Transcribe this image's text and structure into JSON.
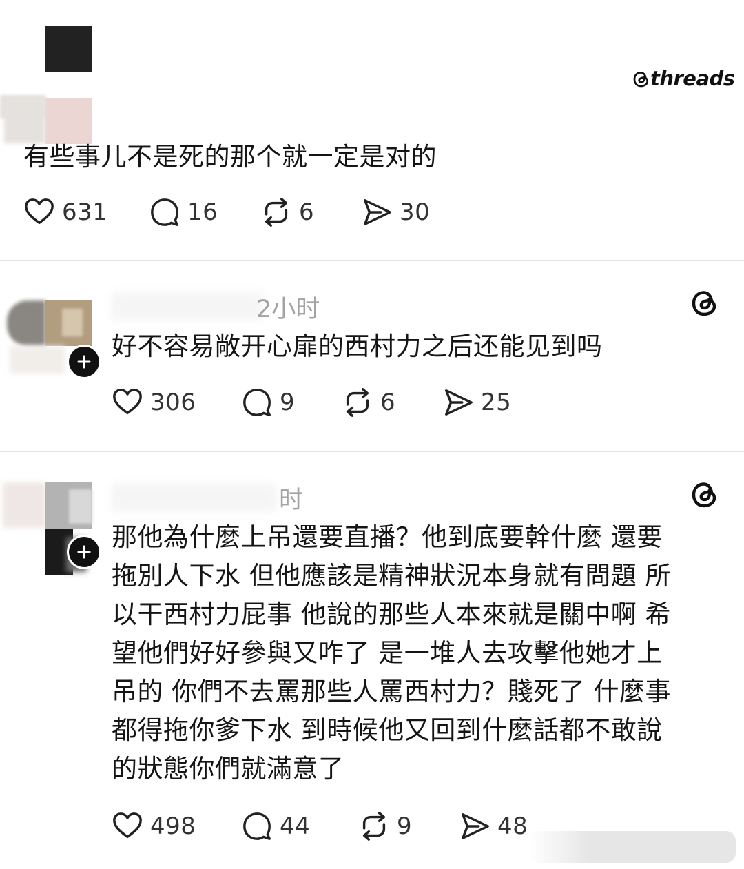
{
  "brand": {
    "name": "threads"
  },
  "posts": [
    {
      "time": "",
      "text": "有些事儿不是死的那个就一定是对的",
      "stats": {
        "likes": "631",
        "comments": "16",
        "reposts": "6",
        "shares": "30"
      }
    },
    {
      "time": "2小时",
      "text": "好不容易敞开心扉的西村力之后还能见到吗",
      "stats": {
        "likes": "306",
        "comments": "9",
        "reposts": "6",
        "shares": "25"
      }
    },
    {
      "time": "时",
      "lines": [
        "那他為什麼上吊還要直播？他到底要幹什麼 還要",
        "拖別人下水 但他應該是精神狀況本身就有問題 所",
        "以干西村力屁事 他說的那些人本來就是關中啊 希",
        "望他們好好參與又咋了 是一堆人去攻擊他她才上",
        "吊的 你們不去罵那些人罵西村力？賤死了 什麼事",
        "都得拖你爹下水 到時候他又回到什麼話都不敢說",
        "的狀態你們就滿意了"
      ],
      "stats": {
        "likes": "498",
        "comments": "44",
        "reposts": "9",
        "shares": "48"
      }
    }
  ],
  "icons": {
    "like": "heart-icon",
    "comment": "comment-bubble-icon",
    "repost": "repost-arrows-icon",
    "share": "send-paper-plane-icon",
    "follow": "plus-icon",
    "threads": "threads-logo-icon"
  },
  "colors": {
    "text": "#151515",
    "muted": "#a3a3a3",
    "divider": "#e4e4e4"
  }
}
